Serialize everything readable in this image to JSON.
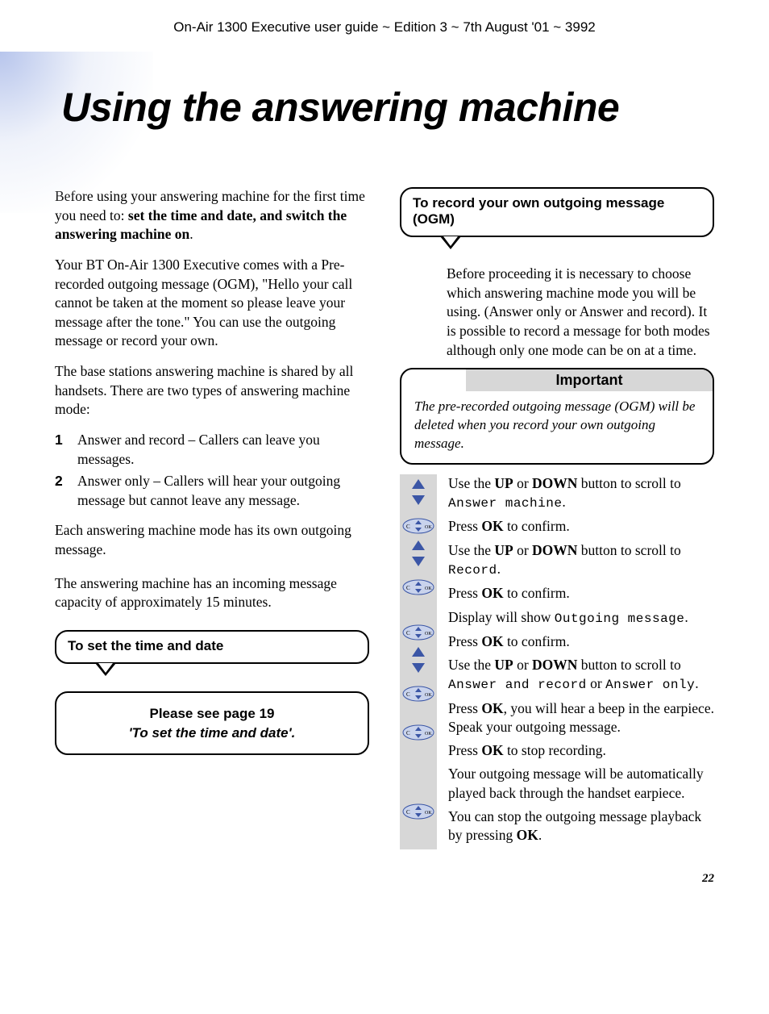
{
  "header": "On-Air 1300 Executive user guide ~ Edition 3 ~ 7th August '01 ~ 3992",
  "title": "Using the answering machine",
  "left": {
    "p1a": "Before using your answering machine for the first time you need to: ",
    "p1b": "set the time and date, and switch the answering machine on",
    "p1c": ".",
    "p2": "Your BT On-Air 1300 Executive comes with a Pre-recorded outgoing message (OGM), \"Hello your call cannot be taken at the moment so please leave your message after the tone.\" You can use the outgoing message or record your own.",
    "p3": "The base stations answering machine is shared by all handsets. There are two types of answering machine mode:",
    "li1": "Answer and record – Callers can leave you messages.",
    "li2": "Answer only – Callers will hear your outgoing message but cannot leave any message.",
    "p4": "Each answering machine mode has its own outgoing message.",
    "p5": "The answering machine has an incoming message capacity of approximately 15 minutes.",
    "callout1": "To set the time and date",
    "note_l1": "Please see page 19",
    "note_l2": "'To set the time and date'."
  },
  "right": {
    "callout2": "To record your own outgoing message (OGM)",
    "intro": "Before proceeding it is necessary to choose which answering machine mode you will be using. (Answer only or Answer and record). It is possible to record a message for both modes although only one mode can be on at a time.",
    "important_title": "Important",
    "important_body": "The pre-recorded outgoing message (OGM) will be deleted when you record your own outgoing message.",
    "s1a": "Use the ",
    "s1b": "UP",
    "s1c": " or ",
    "s1d": "DOWN",
    "s1e": " button to scroll to ",
    "s1f": "Answer machine",
    "s1g": ".",
    "s2a": "Press ",
    "s2b": "OK",
    "s2c": " to confirm.",
    "s3a": "Use the ",
    "s3b": "UP",
    "s3c": " or ",
    "s3d": "DOWN",
    "s3e": " button to scroll to ",
    "s3f": "Record",
    "s3g": ".",
    "s4a": "Press ",
    "s4b": "OK",
    "s4c": " to confirm.",
    "s5a": "Display will show ",
    "s5b": "Outgoing message",
    "s5c": ".",
    "s6a": "Press ",
    "s6b": "OK",
    "s6c": " to confirm.",
    "s7a": "Use the ",
    "s7b": "UP",
    "s7c": " or ",
    "s7d": "DOWN",
    "s7e": " button to scroll to ",
    "s7f": "Answer and record",
    "s7g": " or ",
    "s7h": "Answer only",
    "s7i": ".",
    "s8a": "Press ",
    "s8b": "OK",
    "s8c": ", you will hear a beep in the earpiece. Speak your outgoing message.",
    "s9a": "Press ",
    "s9b": "OK",
    "s9c": " to stop recording.",
    "s10": "Your outgoing message will be automatically played back through the handset earpiece.",
    "s11a": "You can stop the outgoing message playback by pressing ",
    "s11b": "OK",
    "s11c": "."
  },
  "pagenum": "22"
}
